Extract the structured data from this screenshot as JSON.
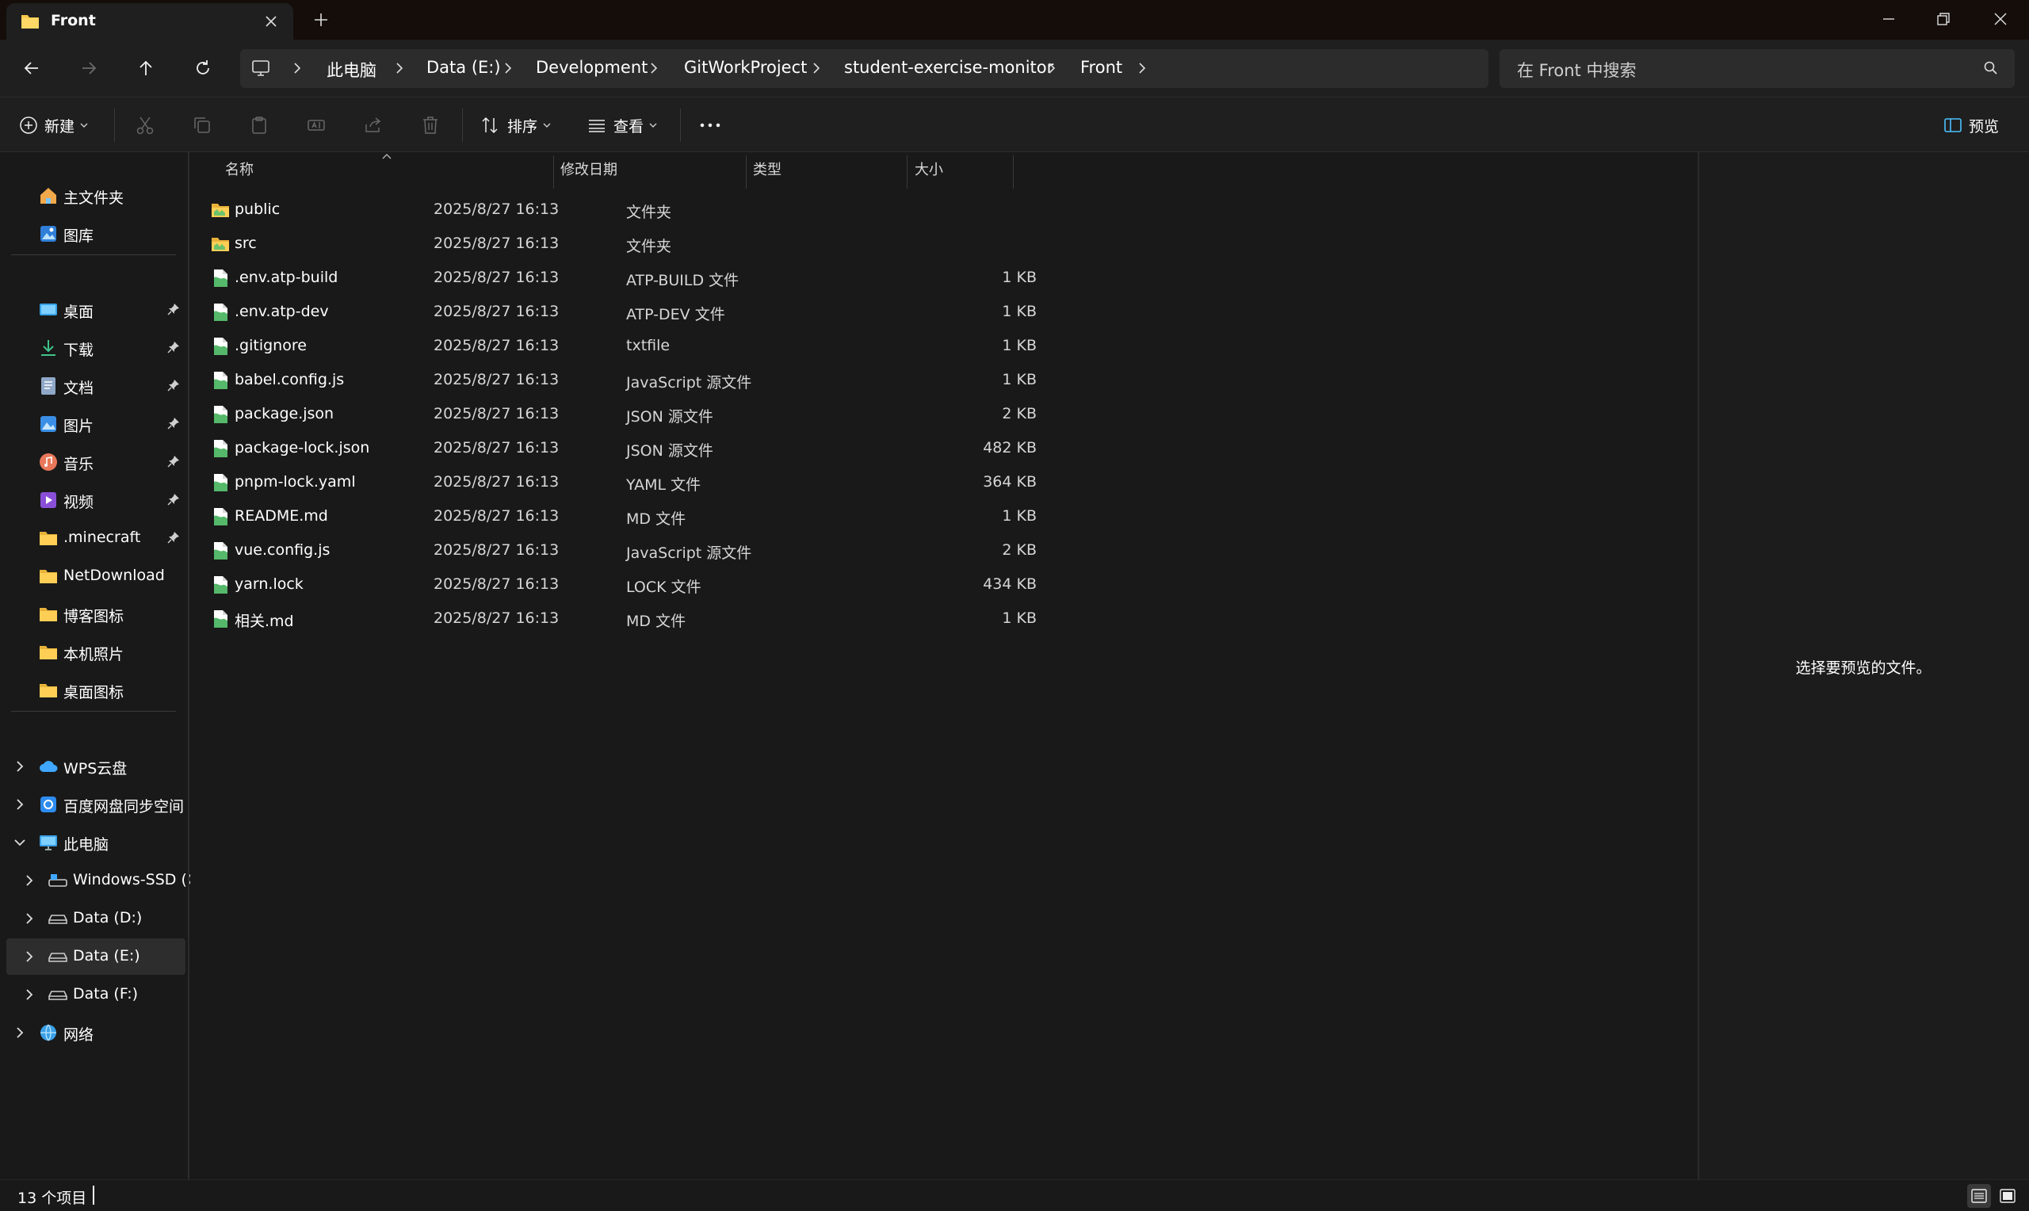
{
  "tab": {
    "title": "Front"
  },
  "breadcrumb": [
    "此电脑",
    "Data (E:)",
    "Development",
    "GitWorkProject",
    "student-exercise-monitor",
    "Front"
  ],
  "search": {
    "placeholder": "在 Front 中搜索"
  },
  "toolbar": {
    "new_label": "新建",
    "sort_label": "排序",
    "view_label": "查看",
    "preview_label": "预览"
  },
  "sidebar": {
    "top": [
      {
        "label": "主文件夹",
        "icon": "home-icon"
      },
      {
        "label": "图库",
        "icon": "gallery-icon"
      }
    ],
    "pinned": [
      {
        "label": "桌面",
        "icon": "desktop-icon"
      },
      {
        "label": "下载",
        "icon": "download-icon"
      },
      {
        "label": "文档",
        "icon": "document-icon"
      },
      {
        "label": "图片",
        "icon": "pictures-icon"
      },
      {
        "label": "音乐",
        "icon": "music-icon"
      },
      {
        "label": "视频",
        "icon": "video-icon"
      },
      {
        "label": ".minecraft",
        "icon": "folder-icon"
      },
      {
        "label": "NetDownload",
        "icon": "folder-icon"
      },
      {
        "label": "博客图标",
        "icon": "folder-icon"
      },
      {
        "label": "本机照片",
        "icon": "folder-icon"
      },
      {
        "label": "桌面图标",
        "icon": "folder-icon"
      }
    ],
    "tree": [
      {
        "label": "WPS云盘",
        "icon": "cloud-icon"
      },
      {
        "label": "百度网盘同步空间",
        "icon": "baidu-icon"
      },
      {
        "label": "此电脑",
        "icon": "computer-icon"
      },
      {
        "label": "Windows-SSD (C",
        "icon": "drive-c-icon"
      },
      {
        "label": "Data (D:)",
        "icon": "drive-icon"
      },
      {
        "label": "Data (E:)",
        "icon": "drive-icon"
      },
      {
        "label": "Data (F:)",
        "icon": "drive-icon"
      },
      {
        "label": "网络",
        "icon": "network-icon"
      }
    ]
  },
  "columns": {
    "name": "名称",
    "date": "修改日期",
    "type": "类型",
    "size": "大小"
  },
  "files": [
    {
      "name": "public",
      "date": "2025/8/27 16:13",
      "type": "文件夹",
      "size": "",
      "kind": "folder"
    },
    {
      "name": "src",
      "date": "2025/8/27 16:13",
      "type": "文件夹",
      "size": "",
      "kind": "folder"
    },
    {
      "name": ".env.atp-build",
      "date": "2025/8/27 16:13",
      "type": "ATP-BUILD 文件",
      "size": "1 KB",
      "kind": "file"
    },
    {
      "name": ".env.atp-dev",
      "date": "2025/8/27 16:13",
      "type": "ATP-DEV 文件",
      "size": "1 KB",
      "kind": "file"
    },
    {
      "name": ".gitignore",
      "date": "2025/8/27 16:13",
      "type": "txtfile",
      "size": "1 KB",
      "kind": "file"
    },
    {
      "name": "babel.config.js",
      "date": "2025/8/27 16:13",
      "type": "JavaScript 源文件",
      "size": "1 KB",
      "kind": "file"
    },
    {
      "name": "package.json",
      "date": "2025/8/27 16:13",
      "type": "JSON 源文件",
      "size": "2 KB",
      "kind": "file"
    },
    {
      "name": "package-lock.json",
      "date": "2025/8/27 16:13",
      "type": "JSON 源文件",
      "size": "482 KB",
      "kind": "file"
    },
    {
      "name": "pnpm-lock.yaml",
      "date": "2025/8/27 16:13",
      "type": "YAML 文件",
      "size": "364 KB",
      "kind": "file"
    },
    {
      "name": "README.md",
      "date": "2025/8/27 16:13",
      "type": "MD 文件",
      "size": "1 KB",
      "kind": "file"
    },
    {
      "name": "vue.config.js",
      "date": "2025/8/27 16:13",
      "type": "JavaScript 源文件",
      "size": "2 KB",
      "kind": "file"
    },
    {
      "name": "yarn.lock",
      "date": "2025/8/27 16:13",
      "type": "LOCK 文件",
      "size": "434 KB",
      "kind": "file"
    },
    {
      "name": "相关.md",
      "date": "2025/8/27 16:13",
      "type": "MD 文件",
      "size": "1 KB",
      "kind": "file"
    }
  ],
  "preview": {
    "message": "选择要预览的文件。"
  },
  "status": {
    "item_count": "13 个项目"
  },
  "colors": {
    "accent": "#4cc2ff",
    "folder": "#f8c94a",
    "file_green": "#55b86a",
    "background": "#191919"
  }
}
